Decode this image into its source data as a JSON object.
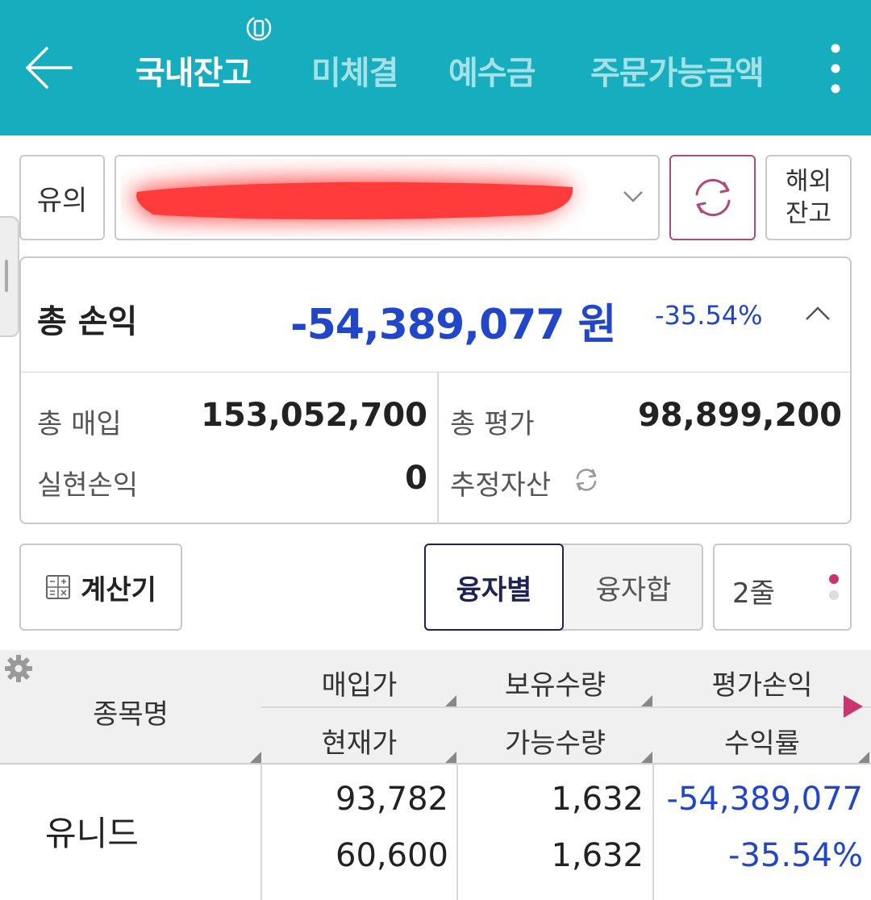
{
  "header": {
    "tabs": [
      {
        "label": "국내잔고",
        "active": true
      },
      {
        "label": "미체결",
        "active": false
      },
      {
        "label": "예수금",
        "active": false
      },
      {
        "label": "주문가능금액",
        "active": false
      }
    ],
    "bg_color": "#16adbf"
  },
  "account": {
    "type_label": "유의",
    "overseas_label_line1": "해외",
    "overseas_label_line2": "잔고"
  },
  "summary": {
    "total_pl_label": "총 손익",
    "total_pl_amount": "-54,389,077 원",
    "total_pl_rate": "-35.54%",
    "total_buy_label": "총 매입",
    "total_buy_value": "153,052,700",
    "total_eval_label": "총 평가",
    "total_eval_value": "98,899,200",
    "realized_label": "실현손익",
    "realized_value": "0",
    "est_assets_label": "추정자산",
    "negative_color": "#2246c9"
  },
  "controls": {
    "calc_label": "계산기",
    "seg_by_loan": "융자별",
    "seg_loan_sum": "융자합",
    "lines_label": "2줄"
  },
  "table": {
    "headers": {
      "name": "종목명",
      "buy_price": "매입가",
      "current_price": "현재가",
      "hold_qty": "보유수량",
      "avail_qty": "가능수량",
      "eval_pl": "평가손익",
      "return_rate": "수익률"
    },
    "rows": [
      {
        "name": "유니드",
        "buy_price": "93,782",
        "current_price": "60,600",
        "hold_qty": "1,632",
        "avail_qty": "1,632",
        "eval_pl": "-54,389,077",
        "return_rate": "-35.54%"
      }
    ]
  }
}
